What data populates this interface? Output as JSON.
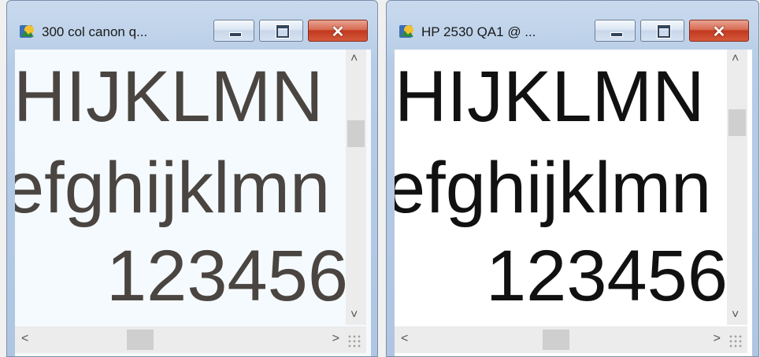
{
  "windows": [
    {
      "title": "300 col canon q...",
      "icon": "app-icon",
      "controls": {
        "minimize": "minimize",
        "maximize": "maximize",
        "close": "✕"
      },
      "lines": [
        "HIJKLMN",
        "efghijklmn",
        "123456"
      ]
    },
    {
      "title": "HP 2530 QA1 @ ...",
      "icon": "app-icon",
      "controls": {
        "minimize": "minimize",
        "maximize": "maximize",
        "close": "✕"
      },
      "lines": [
        "HIJKLMN",
        "efghijklmn",
        "123456"
      ]
    }
  ],
  "scroll": {
    "up": "˄",
    "down": "˅",
    "left": "<",
    "right": ">"
  }
}
